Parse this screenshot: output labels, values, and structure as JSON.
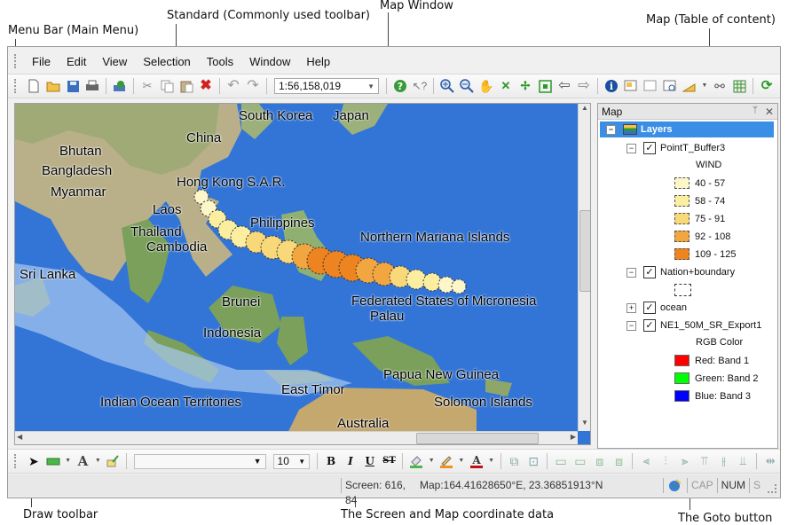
{
  "annotations": {
    "menu_bar": "Menu Bar (Main Menu)",
    "standard": "Standard (Commonly used toolbar)",
    "map_window": "Map Window",
    "toc": "Map (Table of content)",
    "draw_toolbar": "Draw toolbar",
    "coords": "The Screen and Map coordinate data",
    "goto": "The Goto button"
  },
  "menu": [
    "File",
    "Edit",
    "View",
    "Selection",
    "Tools",
    "Window",
    "Help"
  ],
  "toolbar": {
    "scale_value": "1:56,158,019",
    "icons": [
      "new-icon",
      "open-icon",
      "save-icon",
      "print-icon",
      "add-data-icon",
      "cut-icon",
      "copy-icon",
      "paste-icon",
      "delete-icon",
      "undo-icon",
      "redo-icon",
      "help-icon",
      "whats-this-icon",
      "zoom-in-icon",
      "zoom-out-icon",
      "pan-icon",
      "fixed-zoom-in-icon",
      "fixed-zoom-out-icon",
      "full-extent-icon",
      "back-extent-icon",
      "forward-extent-icon",
      "identify-icon",
      "select-features-icon",
      "clear-selection-icon",
      "find-icon",
      "measure-icon",
      "hyperlink-icon",
      "table-icon",
      "refresh-icon"
    ]
  },
  "map": {
    "labels": {
      "south_korea": "South Korea",
      "japan": "Japan",
      "china": "China",
      "bhutan": "Bhutan",
      "bangladesh": "Bangladesh",
      "myanmar": "Myanmar",
      "hong_kong": "Hong Kong S.A.R.",
      "laos": "Laos",
      "thailand": "Thailand",
      "cambodia": "Cambodia",
      "philippines": "Philippines",
      "northern_mariana": "Northern Mariana Islands",
      "sri_lanka": "Sri Lanka",
      "brunei": "Brunei",
      "micronesia": "Federated States of Micronesia",
      "palau": "Palau",
      "indonesia": "Indonesia",
      "papua": "Papua New Guinea",
      "east_timor": "East Timor",
      "indian_ocean": "Indian Ocean Territories",
      "solomon": "Solomon Islands",
      "australia": "Australia"
    }
  },
  "toc": {
    "title": "Map",
    "root": "Layers",
    "layer1": "PointT_Buffer3",
    "wind_label": "WIND",
    "wind_classes": [
      {
        "label": "40 - 57",
        "color": "#fdf6c8"
      },
      {
        "label": "58 - 74",
        "color": "#fbeea0"
      },
      {
        "label": "75 - 91",
        "color": "#f8d878"
      },
      {
        "label": "92 - 108",
        "color": "#f2a640"
      },
      {
        "label": "109 - 125",
        "color": "#ed8420"
      }
    ],
    "layer2": "Nation+boundary",
    "layer3": "ocean",
    "layer4": "NE1_50M_SR_Export1",
    "rgb_label": "RGB Color",
    "bands": [
      {
        "label": "Red: Band 1",
        "color": "#ff0000"
      },
      {
        "label": "Green: Band 2",
        "color": "#00ff00"
      },
      {
        "label": "Blue: Band 3",
        "color": "#0000ff"
      }
    ]
  },
  "draw": {
    "font_size": "10",
    "bold": "B",
    "italic": "I",
    "underline": "U",
    "strike": "ST"
  },
  "status": {
    "screen": "Screen: 616, 84",
    "map": "Map:164.41628650°E, 23.36851913°N",
    "cap": "CAP",
    "num": "NUM",
    "scrl": "S"
  }
}
